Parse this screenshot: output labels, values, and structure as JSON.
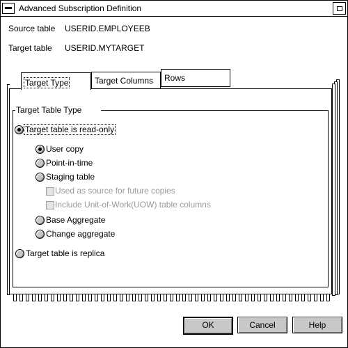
{
  "window": {
    "title": "Advanced Subscription Definition"
  },
  "fields": {
    "source_label": "Source table",
    "source_value": "USERID.EMPLOYEEB",
    "target_label": "Target table",
    "target_value": "USERID.MYTARGET"
  },
  "tabs": [
    {
      "label": "Target Type",
      "active": true
    },
    {
      "label": "Target Columns",
      "active": false
    },
    {
      "label": "Rows",
      "active": false
    }
  ],
  "group": {
    "legend": "Target Table Type",
    "read_only": {
      "label": "Target table is read-only",
      "checked": true
    },
    "user_copy": {
      "label": "User copy",
      "checked": true
    },
    "point_in_time": {
      "label": "Point-in-time",
      "checked": false
    },
    "staging_table": {
      "label": "Staging table",
      "checked": false
    },
    "used_as_source": {
      "label": "Used as source for future copies",
      "enabled": false
    },
    "include_uow": {
      "label": "Include Unit-of-Work(UOW) table columns",
      "enabled": false
    },
    "base_aggregate": {
      "label": "Base Aggregate",
      "checked": false
    },
    "change_aggregate": {
      "label": "Change aggregate",
      "checked": false
    },
    "replica": {
      "label": "Target table is replica",
      "checked": false
    }
  },
  "buttons": {
    "ok": "OK",
    "cancel": "Cancel",
    "help": "Help"
  },
  "colors": {
    "button_face": "#c8c8c8",
    "disabled_text": "#9a9a9a",
    "border": "#000000"
  }
}
